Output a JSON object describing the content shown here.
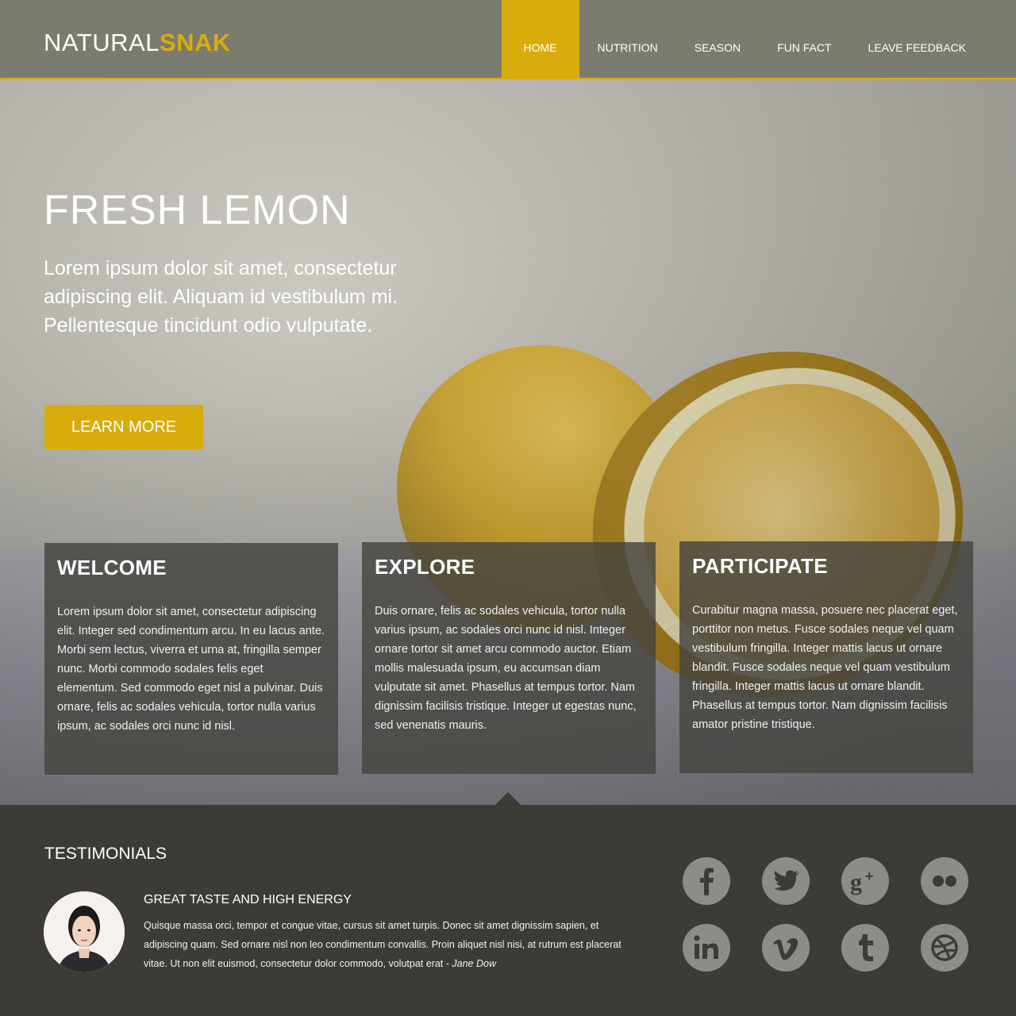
{
  "brand": {
    "part1": "NATURAL",
    "part2": "SNAK",
    "accent": "#d8ad0b"
  },
  "nav": {
    "items": [
      {
        "label": "HOME",
        "active": true
      },
      {
        "label": "NUTRITION",
        "active": false
      },
      {
        "label": "SEASON",
        "active": false
      },
      {
        "label": "FUN FACT",
        "active": false
      },
      {
        "label": "LEAVE FEEDBACK",
        "active": false
      }
    ]
  },
  "hero": {
    "title": "FRESH LEMON",
    "text": "Lorem ipsum dolor sit amet, consectetur adipiscing elit. Aliquam id vestibulum mi. Pellentesque tincidunt odio vulputate.",
    "button": "LEARN MORE"
  },
  "cards": [
    {
      "title": "WELCOME",
      "body": "Lorem ipsum dolor sit amet, consectetur adipiscing elit. Integer sed condimentum arcu. In eu lacus ante. Morbi sem lectus, viverra et urna at, fringilla semper nunc. Morbi commodo sodales felis eget elementum. Sed commodo eget nisl a pulvinar. Duis ornare, felis ac sodales vehicula, tortor nulla varius ipsum, ac sodales orci nunc id nisl."
    },
    {
      "title": "EXPLORE",
      "body": "Duis ornare, felis ac sodales vehicula, tortor nulla varius ipsum, ac sodales orci nunc id nisl. Integer ornare tortor sit amet arcu commodo auctor. Etiam mollis malesuada ipsum, eu accumsan diam vulputate sit amet. Phasellus at tempus tortor. Nam dignissim facilisis tristique. Integer ut egestas nunc, sed venenatis mauris."
    },
    {
      "title": "PARTICIPATE",
      "body": "Curabitur magna massa, posuere nec placerat eget, porttitor non metus. Fusce sodales neque vel quam vestibulum fringilla. Integer mattis lacus ut ornare blandit. Fusce sodales neque vel quam vestibulum fringilla. Integer mattis lacus ut ornare blandit. Phasellus at tempus tortor. Nam dignissim facilisis amator pristine tristique."
    }
  ],
  "testimonials": {
    "title": "TESTIMONIALS",
    "quote_title": "GREAT TASTE AND HIGH ENERGY",
    "quote_text": "Quisque massa orci, tempor et congue vitae, cursus sit amet turpis. Donec sit amet dignissim sapien, et adipiscing quam. Sed ornare nisl non leo condimentum convallis. Proin aliquet nisl nisi, at rutrum est placerat vitae. Ut non elit euismod, consectetur dolor commodo, volutpat erat -",
    "author": "Jane Dow"
  },
  "social": [
    {
      "icon": "facebook-icon",
      "glyph": "f"
    },
    {
      "icon": "twitter-icon",
      "glyph": ""
    },
    {
      "icon": "google-plus-icon",
      "glyph": "g+"
    },
    {
      "icon": "flickr-icon",
      "glyph": ""
    },
    {
      "icon": "linkedin-icon",
      "glyph": "in"
    },
    {
      "icon": "vimeo-icon",
      "glyph": "v"
    },
    {
      "icon": "tumblr-icon",
      "glyph": "t"
    },
    {
      "icon": "dribbble-icon",
      "glyph": ""
    }
  ]
}
